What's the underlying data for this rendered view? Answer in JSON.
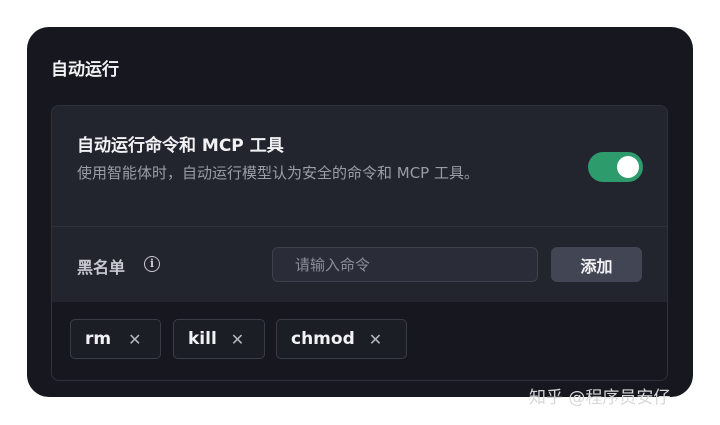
{
  "section": {
    "title": "自动运行"
  },
  "auto_run": {
    "title": "自动运行命令和 MCP 工具",
    "description": "使用智能体时，自动运行模型认为安全的命令和 MCP 工具。",
    "toggle_on": true,
    "toggle_color": "#2e9b6c"
  },
  "blacklist": {
    "label": "黑名单",
    "info_icon": "info-icon",
    "input_placeholder": "请输入命令",
    "input_value": "",
    "add_label": "添加",
    "tags": [
      {
        "label": "rm",
        "close": "✕"
      },
      {
        "label": "kill",
        "close": "✕"
      },
      {
        "label": "chmod",
        "close": "✕"
      }
    ]
  },
  "watermark": {
    "text": "知乎 @程序员安仔"
  }
}
